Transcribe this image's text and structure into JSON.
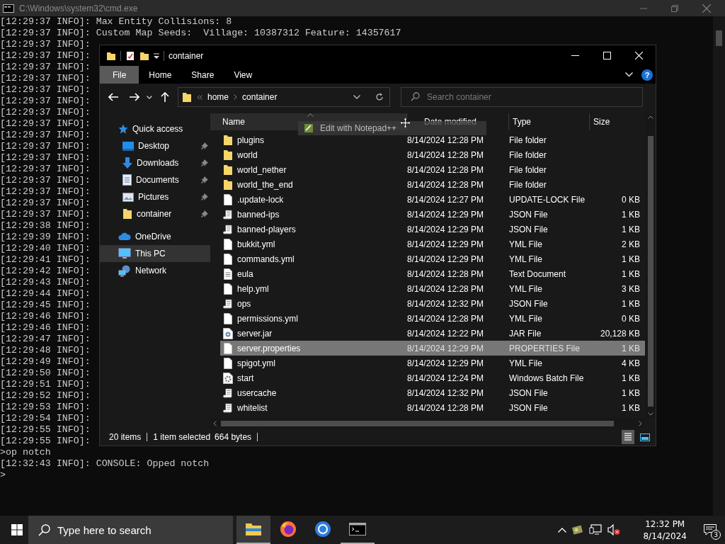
{
  "console": {
    "title": "C:\\Windows\\system32\\cmd.exe",
    "lines": [
      "[12:29:37 INFO]: Max Entity Collisions: 8",
      "[12:29:37 INFO]: Custom Map Seeds:  Village: 10387312 Feature: 14357617",
      "[12:29:37 INFO]:",
      "[12:29:37 INFO]:",
      "[12:29:37 INFO]:",
      "[12:29:37 INFO]:",
      "[12:29:37 INFO]:",
      "[12:29:37 INFO]:",
      "[12:29:37 INFO]:",
      "[12:29:37 INFO]:",
      "[12:29:37 INFO]:",
      "[12:29:37 INFO]:",
      "[12:29:37 INFO]:",
      "[12:29:37 INFO]:",
      "[12:29:37 INFO]:",
      "[12:29:37 INFO]:",
      "[12:29:37 INFO]:",
      "[12:29:37 INFO]:",
      "[12:29:38 INFO]:",
      "[12:29:39 INFO]:",
      "[12:29:40 INFO]:",
      "[12:29:41 INFO]:",
      "[12:29:42 INFO]:",
      "[12:29:43 INFO]:",
      "[12:29:44 INFO]:",
      "[12:29:45 INFO]:",
      "[12:29:46 INFO]:",
      "[12:29:46 INFO]:",
      "[12:29:47 INFO]:",
      "[12:29:48 INFO]:",
      "[12:29:49 INFO]:",
      "[12:29:50 INFO]:",
      "[12:29:51 INFO]:",
      "[12:29:52 INFO]:",
      "[12:29:53 INFO]:",
      "[12:29:54 INFO]:",
      "[12:29:55 INFO]:",
      "[12:29:55 INFO]:",
      ">op notch",
      "[12:32:43 INFO]: CONSOLE: Opped notch",
      ">"
    ]
  },
  "explorer": {
    "title": "container",
    "ribbon_tabs": [
      {
        "label": "File",
        "selected": true
      },
      {
        "label": "Home",
        "selected": false
      },
      {
        "label": "Share",
        "selected": false
      },
      {
        "label": "View",
        "selected": false
      }
    ],
    "help_label": "?",
    "address": {
      "crumbs": [
        "home",
        "container"
      ]
    },
    "search": {
      "placeholder": "Search container"
    },
    "sidebar": [
      {
        "label": "Quick access",
        "kind": "star",
        "selected": false,
        "children": [
          {
            "label": "Desktop",
            "kind": "desktop",
            "pinned": true,
            "selected": false
          },
          {
            "label": "Downloads",
            "kind": "download",
            "pinned": true,
            "selected": false
          },
          {
            "label": "Documents",
            "kind": "document",
            "pinned": true,
            "selected": false
          },
          {
            "label": "Pictures",
            "kind": "pictures",
            "pinned": true,
            "selected": false
          },
          {
            "label": "container",
            "kind": "folder",
            "pinned": true,
            "selected": false
          }
        ]
      },
      {
        "label": "OneDrive",
        "kind": "cloud",
        "selected": false
      },
      {
        "label": "This PC",
        "kind": "computer",
        "selected": true
      },
      {
        "label": "Network",
        "kind": "network",
        "selected": false
      }
    ],
    "columns": [
      "Name",
      "Date modified",
      "Type",
      "Size"
    ],
    "files": [
      {
        "name": "plugins",
        "date": "8/14/2024 12:28 PM",
        "type": "File folder",
        "kind": "folder",
        "selected": false
      },
      {
        "name": "world",
        "date": "8/14/2024 12:28 PM",
        "type": "File folder",
        "kind": "folder",
        "selected": false
      },
      {
        "name": "world_nether",
        "date": "8/14/2024 12:28 PM",
        "type": "File folder",
        "kind": "folder",
        "selected": false
      },
      {
        "name": "world_the_end",
        "date": "8/14/2024 12:28 PM",
        "type": "File folder",
        "kind": "folder",
        "selected": false
      },
      {
        "name": ".update-lock",
        "date": "8/14/2024 12:27 PM",
        "type": "UPDATE-LOCK File",
        "size": "0 KB",
        "kind": "file",
        "selected": false
      },
      {
        "name": "banned-ips",
        "date": "8/14/2024 12:29 PM",
        "type": "JSON File",
        "size": "1 KB",
        "kind": "script",
        "selected": false
      },
      {
        "name": "banned-players",
        "date": "8/14/2024 12:29 PM",
        "type": "JSON File",
        "size": "1 KB",
        "kind": "script",
        "selected": false
      },
      {
        "name": "bukkit.yml",
        "date": "8/14/2024 12:29 PM",
        "type": "YML File",
        "size": "2 KB",
        "kind": "file",
        "selected": false
      },
      {
        "name": "commands.yml",
        "date": "8/14/2024 12:29 PM",
        "type": "YML File",
        "size": "1 KB",
        "kind": "file",
        "selected": false
      },
      {
        "name": "eula",
        "date": "8/14/2024 12:28 PM",
        "type": "Text Document",
        "size": "1 KB",
        "kind": "text",
        "selected": false
      },
      {
        "name": "help.yml",
        "date": "8/14/2024 12:28 PM",
        "type": "YML File",
        "size": "3 KB",
        "kind": "file",
        "selected": false
      },
      {
        "name": "ops",
        "date": "8/14/2024 12:32 PM",
        "type": "JSON File",
        "size": "1 KB",
        "kind": "script",
        "selected": false
      },
      {
        "name": "permissions.yml",
        "date": "8/14/2024 12:28 PM",
        "type": "YML File",
        "size": "0 KB",
        "kind": "file",
        "selected": false
      },
      {
        "name": "server.jar",
        "date": "8/14/2024 12:22 PM",
        "type": "JAR File",
        "size": "20,128 KB",
        "kind": "jar",
        "selected": false
      },
      {
        "name": "server.properties",
        "date": "8/14/2024 12:29 PM",
        "type": "PROPERTIES File",
        "size": "1 KB",
        "kind": "file",
        "selected": true
      },
      {
        "name": "spigot.yml",
        "date": "8/14/2024 12:29 PM",
        "type": "YML File",
        "size": "4 KB",
        "kind": "file",
        "selected": false
      },
      {
        "name": "start",
        "date": "8/14/2024 12:24 PM",
        "type": "Windows Batch File",
        "size": "1 KB",
        "kind": "batch",
        "selected": false
      },
      {
        "name": "usercache",
        "date": "8/14/2024 12:32 PM",
        "type": "JSON File",
        "size": "1 KB",
        "kind": "script",
        "selected": false
      },
      {
        "name": "whitelist",
        "date": "8/14/2024 12:28 PM",
        "type": "JSON File",
        "size": "1 KB",
        "kind": "script",
        "selected": false
      }
    ],
    "status": {
      "items": "20 items",
      "selection": "1 item selected",
      "size": "664 bytes"
    },
    "view_modes": [
      {
        "kind": "details",
        "selected": true
      },
      {
        "kind": "tiles",
        "selected": false
      }
    ],
    "drag_tooltip": "Edit with Notepad++"
  },
  "taskbar": {
    "search": {
      "placeholder": "Type here to search"
    },
    "apps": [
      {
        "kind": "explorer",
        "active": true
      },
      {
        "kind": "firefox",
        "active": false
      },
      {
        "kind": "chrome",
        "active": false
      },
      {
        "kind": "terminal",
        "active": true
      }
    ],
    "time": "12:32 PM",
    "date": "8/14/2024",
    "notifications": "3"
  }
}
